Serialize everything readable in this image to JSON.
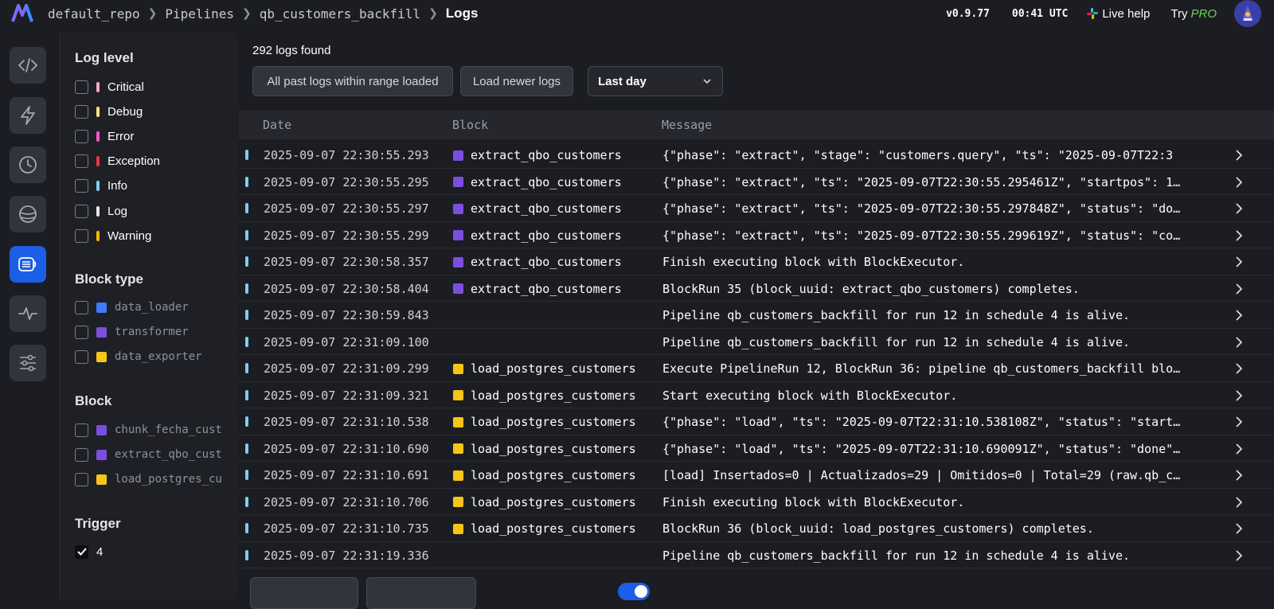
{
  "header": {
    "breadcrumbs": [
      "default_repo",
      "Pipelines",
      "qb_customers_backfill",
      "Logs"
    ],
    "version": "v0.9.77",
    "time": "00:41 UTC",
    "live_help": "Live help",
    "try_label": "Try",
    "pro_label": "PRO"
  },
  "filters": {
    "log_level": {
      "title": "Log level",
      "items": [
        {
          "label": "Critical",
          "color": "#f6a5c0"
        },
        {
          "label": "Debug",
          "color": "#f7e27a"
        },
        {
          "label": "Error",
          "color": "#f454c8"
        },
        {
          "label": "Exception",
          "color": "#f0304a"
        },
        {
          "label": "Info",
          "color": "#7ecdf2"
        },
        {
          "label": "Log",
          "color": "#e6e6e6"
        },
        {
          "label": "Warning",
          "color": "#f5b800"
        }
      ]
    },
    "block_type": {
      "title": "Block type",
      "items": [
        {
          "label": "data_loader",
          "color": "#3d7bff"
        },
        {
          "label": "transformer",
          "color": "#7b4ee0"
        },
        {
          "label": "data_exporter",
          "color": "#f5c518"
        }
      ]
    },
    "block": {
      "title": "Block",
      "items": [
        {
          "label": "chunk_fecha_cust",
          "color": "#7b4ee0"
        },
        {
          "label": "extract_qbo_cust",
          "color": "#7b4ee0"
        },
        {
          "label": "load_postgres_cu",
          "color": "#f5c518"
        }
      ]
    },
    "trigger": {
      "title": "Trigger",
      "items": [
        {
          "label": "4",
          "checked": true
        }
      ]
    }
  },
  "main": {
    "count": "292 logs found",
    "btn_past": "All past logs within range loaded",
    "btn_newer": "Load newer logs",
    "range": "Last day",
    "columns": [
      "Date",
      "Block",
      "Message"
    ]
  },
  "logs": [
    {
      "date": "2025-09-07 22:30:55.293",
      "block": "extract_qbo_customers",
      "color": "#7b4ee0",
      "message": "{\"phase\": \"extract\", \"stage\": \"customers.query\", \"ts\": \"2025-09-07T22:3"
    },
    {
      "date": "2025-09-07 22:30:55.295",
      "block": "extract_qbo_customers",
      "color": "#7b4ee0",
      "message": "{\"phase\": \"extract\", \"ts\": \"2025-09-07T22:30:55.295461Z\", \"startpos\": 1…"
    },
    {
      "date": "2025-09-07 22:30:55.297",
      "block": "extract_qbo_customers",
      "color": "#7b4ee0",
      "message": "{\"phase\": \"extract\", \"ts\": \"2025-09-07T22:30:55.297848Z\", \"status\": \"do…"
    },
    {
      "date": "2025-09-07 22:30:55.299",
      "block": "extract_qbo_customers",
      "color": "#7b4ee0",
      "message": "{\"phase\": \"extract\", \"ts\": \"2025-09-07T22:30:55.299619Z\", \"status\": \"co…"
    },
    {
      "date": "2025-09-07 22:30:58.357",
      "block": "extract_qbo_customers",
      "color": "#7b4ee0",
      "message": "Finish executing block with BlockExecutor."
    },
    {
      "date": "2025-09-07 22:30:58.404",
      "block": "extract_qbo_customers",
      "color": "#7b4ee0",
      "message": "BlockRun 35 (block_uuid: extract_qbo_customers) completes."
    },
    {
      "date": "2025-09-07 22:30:59.843",
      "block": "",
      "color": "",
      "message": "Pipeline qb_customers_backfill for run 12 in schedule 4 is alive."
    },
    {
      "date": "2025-09-07 22:31:09.100",
      "block": "",
      "color": "",
      "message": "Pipeline qb_customers_backfill for run 12 in schedule 4 is alive."
    },
    {
      "date": "2025-09-07 22:31:09.299",
      "block": "load_postgres_customers",
      "color": "#f5c518",
      "message": "Execute PipelineRun 12, BlockRun 36: pipeline qb_customers_backfill blo…"
    },
    {
      "date": "2025-09-07 22:31:09.321",
      "block": "load_postgres_customers",
      "color": "#f5c518",
      "message": "Start executing block with BlockExecutor."
    },
    {
      "date": "2025-09-07 22:31:10.538",
      "block": "load_postgres_customers",
      "color": "#f5c518",
      "message": "{\"phase\": \"load\", \"ts\": \"2025-09-07T22:31:10.538108Z\", \"status\": \"start…"
    },
    {
      "date": "2025-09-07 22:31:10.690",
      "block": "load_postgres_customers",
      "color": "#f5c518",
      "message": "{\"phase\": \"load\", \"ts\": \"2025-09-07T22:31:10.690091Z\", \"status\": \"done\"…"
    },
    {
      "date": "2025-09-07 22:31:10.691",
      "block": "load_postgres_customers",
      "color": "#f5c518",
      "message": "[load] Insertados=0 | Actualizados=29 | Omitidos=0 | Total=29 (raw.qb_c…"
    },
    {
      "date": "2025-09-07 22:31:10.706",
      "block": "load_postgres_customers",
      "color": "#f5c518",
      "message": "Finish executing block with BlockExecutor."
    },
    {
      "date": "2025-09-07 22:31:10.735",
      "block": "load_postgres_customers",
      "color": "#f5c518",
      "message": "BlockRun 36 (block_uuid: load_postgres_customers) completes."
    },
    {
      "date": "2025-09-07 22:31:19.336",
      "block": "",
      "color": "",
      "message": "Pipeline qb_customers_backfill for run 12 in schedule 4 is alive."
    }
  ],
  "rail_icons": [
    "code-icon",
    "trigger-icon",
    "clock-icon",
    "backfill-icon",
    "logs-icon",
    "monitor-icon",
    "settings-icon"
  ]
}
